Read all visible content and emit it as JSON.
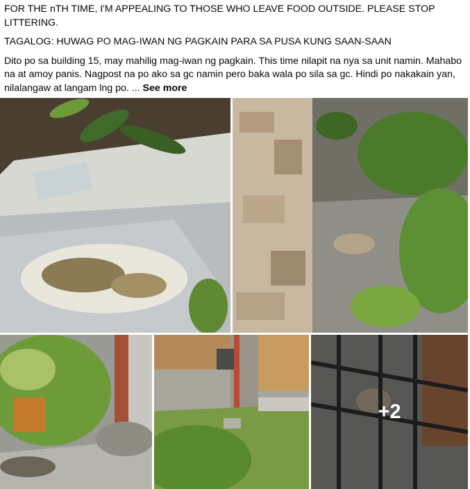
{
  "post": {
    "line1": "FOR THE nTH TIME, I'M APPEALING TO THOSE WHO LEAVE FOOD OUTSIDE. PLEASE STOP LITTERING.",
    "line2": "TAGALOG: HUWAG PO MAG-IWAN NG PAGKAIN PARA SA PUSA KUNG SAAN-SAAN",
    "body": "Dito po sa building 15, may mahilig mag-iwan ng pagkain. This time nilapit na nya sa unit namin. Mahabo na at amoy panis. Nagpost na po ako sa gc namin pero baka wala po sila sa gc. Hindi po nakakain yan, nilalangaw at langam lng po. ... ",
    "see_more": "See more"
  },
  "photos": {
    "more_count": "+2"
  }
}
